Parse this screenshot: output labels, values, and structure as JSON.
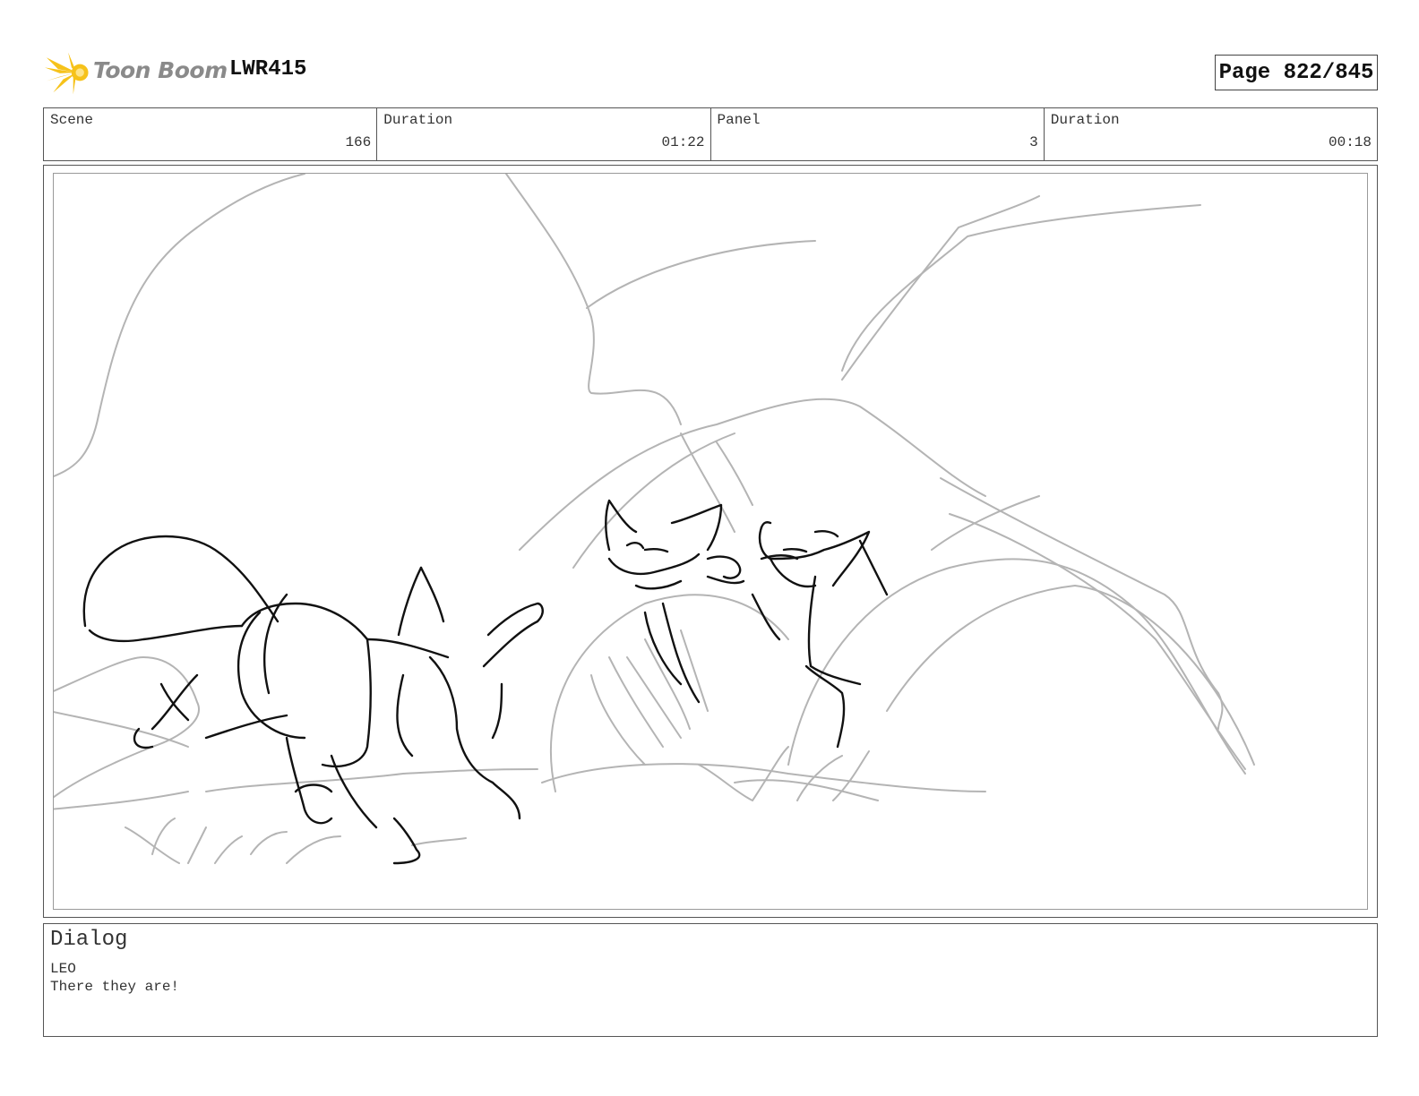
{
  "header": {
    "brand": "Toon Boom",
    "project_code": "LWR415",
    "page_label": "Page 822/845"
  },
  "info": {
    "scene": {
      "label": "Scene",
      "value": "166"
    },
    "scene_duration": {
      "label": "Duration",
      "value": "01:22"
    },
    "panel": {
      "label": "Panel",
      "value": "3"
    },
    "panel_duration": {
      "label": "Duration",
      "value": "00:18"
    }
  },
  "dialog": {
    "title": "Dialog",
    "character": "LEO",
    "line": "There they are!"
  },
  "colors": {
    "logo_yellow": "#f6c21a",
    "sketch_gray": "#b4b4b4",
    "sketch_black": "#111111"
  },
  "icons": {
    "logo": "toon-boom-sunburst-icon"
  }
}
